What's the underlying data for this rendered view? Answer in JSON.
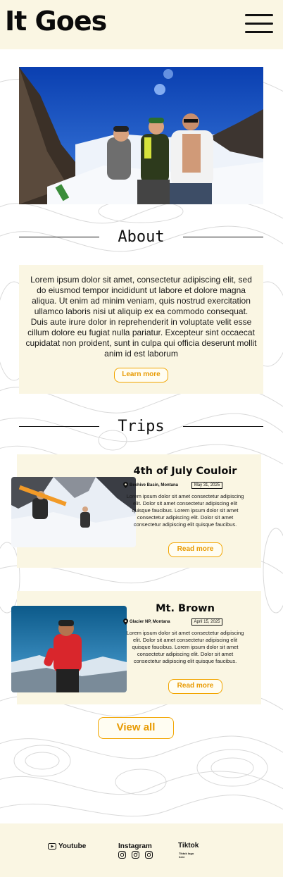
{
  "header": {
    "brand": "It Goes",
    "menu_icon": "hamburger-menu-icon"
  },
  "hero": {
    "image_alt": "Three skiers posing on a snowy mountain under blue sky"
  },
  "about": {
    "heading": "About",
    "body": "Lorem ipsum dolor sit amet, consectetur adipiscing elit, sed do eiusmod tempor incididunt ut labore et dolore magna aliqua. Ut enim ad minim veniam, quis nostrud exercitation ullamco laboris nisi ut aliquip ex ea commodo consequat. Duis aute irure dolor in reprehenderit in voluptate velit esse cillum dolore eu fugiat nulla pariatur. Excepteur sint occaecat cupidatat non proident, sunt in culpa qui officia deserunt mollit anim id est laborum",
    "button_label": "Learn more"
  },
  "trips": {
    "heading": "Trips",
    "items": [
      {
        "title": "4th of July Couloir",
        "location": "Beehive Basin, Montana",
        "date": "May 31, 2025",
        "description": "Lorem ipsum dolor sit amet consectetur adipiscing elit. Dolor sit amet consectetur adipiscing elit quisque faucibus. Lorem ipsum dolor sit amet consectetur adipiscing elit. Dolor sit amet consectetur adipiscing elit quisque faucibus.",
        "button_label": "Read more"
      },
      {
        "title": "Mt. Brown",
        "location": "Glacier NP, Montana",
        "date": "April 15, 2025",
        "description": "Lorem ipsum dolor sit amet consectetur adipiscing elit. Dolor sit amet consectetur adipiscing elit quisque faucibus. Lorem ipsum dolor sit amet consectetur adipiscing elit. Dolor sit amet consectetur adipiscing elit quisque faucibus.",
        "button_label": "Read more"
      }
    ],
    "view_all_label": "View all"
  },
  "footer": {
    "youtube": "Youtube",
    "instagram": "Instagram",
    "tiktok": "Tiktok",
    "tiktok_note": "Tiktok logo here"
  },
  "colors": {
    "cream": "#faf6e3",
    "accent": "#f2a500",
    "accent_text": "#e89a00",
    "ink": "#111111"
  }
}
